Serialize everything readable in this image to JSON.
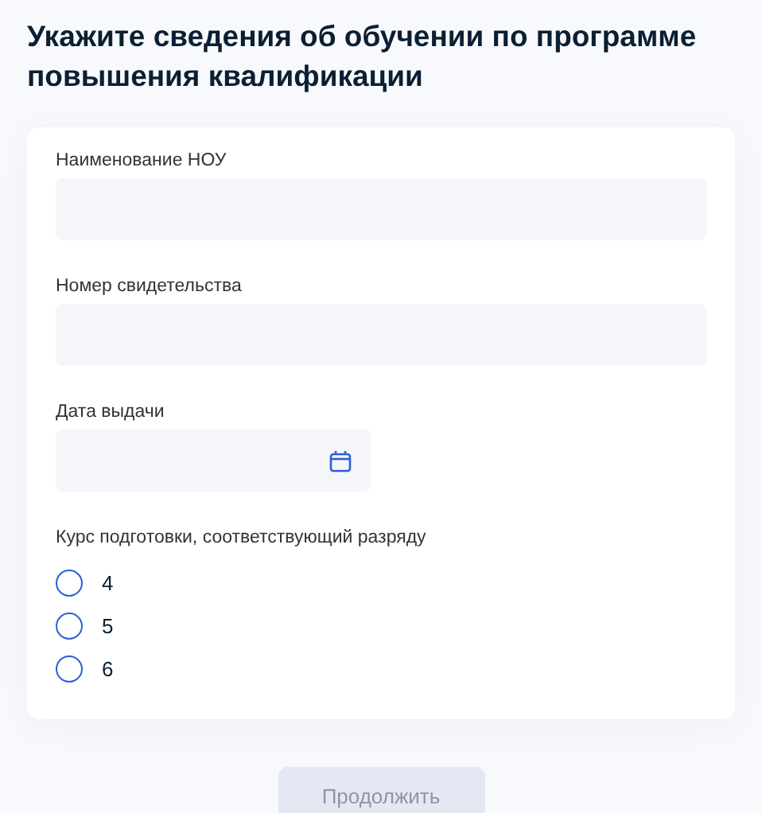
{
  "title": "Укажите сведения об обучении по программе повышения квалификации",
  "fields": [
    {
      "label": "Наименование НОУ",
      "kind": "text"
    },
    {
      "label": "Номер свидетельства",
      "kind": "text"
    },
    {
      "label": "Дата выдачи",
      "kind": "date"
    }
  ],
  "radio_group": {
    "label": "Курс подготовки, соответствующий разряду",
    "options": [
      {
        "label": "4",
        "selected": false
      },
      {
        "label": "5",
        "selected": false
      },
      {
        "label": "6",
        "selected": false
      }
    ]
  },
  "continue_button": {
    "label": "Продолжить",
    "disabled": true
  }
}
